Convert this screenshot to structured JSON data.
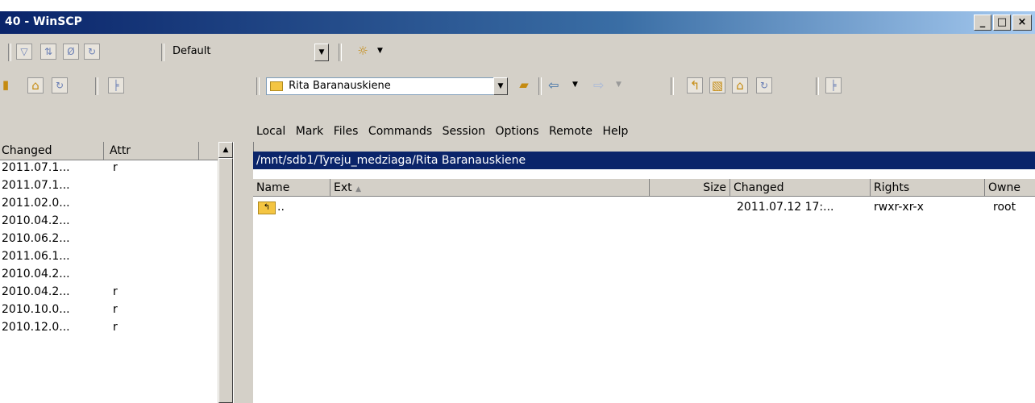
{
  "window": {
    "title": "40 - WinSCP",
    "min_label": "_",
    "max_label": "□",
    "close_label": "×"
  },
  "toolbar": {
    "transfer_settings": "Default",
    "remote_dir": "Rita Baranauskiene"
  },
  "menu": [
    "Local",
    "Mark",
    "Files",
    "Commands",
    "Session",
    "Options",
    "Remote",
    "Help"
  ],
  "left_panel": {
    "columns": [
      "Changed",
      "Attr"
    ],
    "rows": [
      {
        "changed": "2011.07.1...",
        "attr": "r"
      },
      {
        "changed": "2011.07.1...",
        "attr": ""
      },
      {
        "changed": "2011.02.0...",
        "attr": ""
      },
      {
        "changed": "2010.04.2...",
        "attr": ""
      },
      {
        "changed": "2010.06.2...",
        "attr": ""
      },
      {
        "changed": "2011.06.1...",
        "attr": ""
      },
      {
        "changed": "2010.04.2...",
        "attr": ""
      },
      {
        "changed": "2010.04.2...",
        "attr": "r"
      },
      {
        "changed": "2010.10.0...",
        "attr": "r"
      },
      {
        "changed": "2010.12.0...",
        "attr": "r"
      }
    ]
  },
  "remote_panel": {
    "path": "/mnt/sdb1/Tyreju_medziaga/Rita Baranauskiene",
    "columns": {
      "name": "Name",
      "ext": "Ext",
      "size": "Size",
      "changed": "Changed",
      "rights": "Rights",
      "owner": "Owne"
    },
    "rows": [
      {
        "name": "..",
        "size": "",
        "changed": "2011.07.12 17:...",
        "rights": "rwxr-xr-x",
        "owner": "root"
      }
    ]
  }
}
